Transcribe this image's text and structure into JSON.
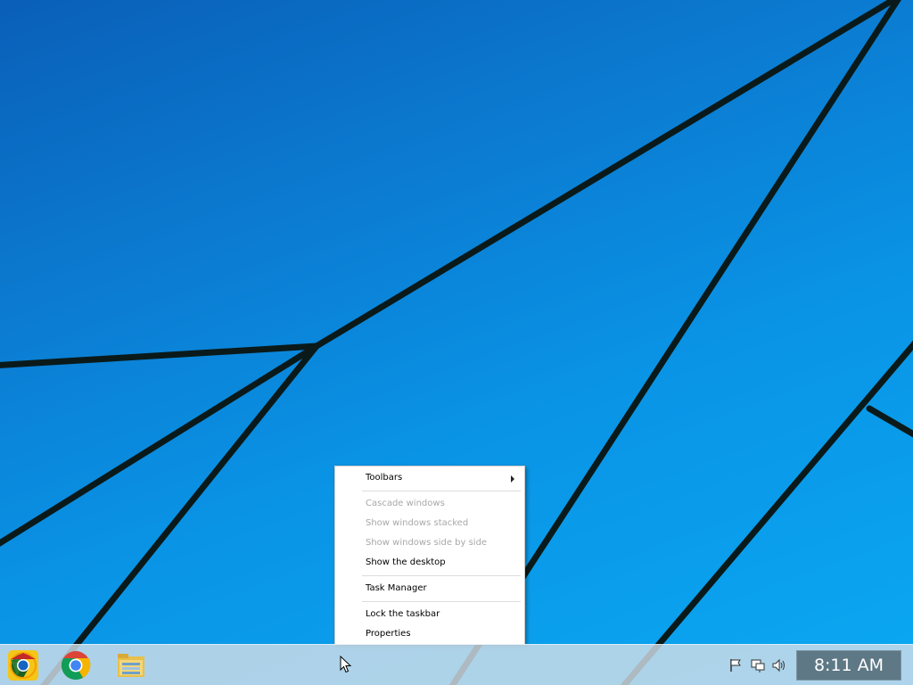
{
  "context_menu": {
    "toolbars": "Toolbars",
    "cascade": "Cascade windows",
    "stacked": "Show windows stacked",
    "side_by_side": "Show windows side by side",
    "show_desktop": "Show the desktop",
    "task_manager": "Task Manager",
    "lock_taskbar": "Lock the taskbar",
    "properties": "Properties"
  },
  "taskbar": {
    "pinned": [
      "chrome-canary-icon",
      "chrome-icon",
      "file-explorer-icon"
    ],
    "tray": [
      "action-center-flag-icon",
      "network-icon",
      "volume-icon"
    ],
    "clock": "8:11 AM"
  },
  "colors": {
    "wallpaper": "#0a94e6",
    "menu_disabled_text": "#a8a8a8",
    "clock_background": "#5e7886"
  }
}
